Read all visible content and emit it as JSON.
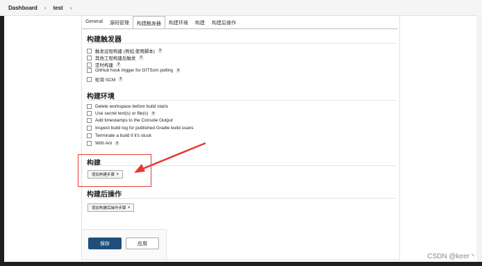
{
  "breadcrumb": {
    "dashboard": "Dashboard",
    "job": "test"
  },
  "tabs": [
    {
      "label": "General"
    },
    {
      "label": "源码管理"
    },
    {
      "label": "构建触发器"
    },
    {
      "label": "构建环境"
    },
    {
      "label": "构建"
    },
    {
      "label": "构建后操作"
    }
  ],
  "triggers": {
    "title": "构建触发器",
    "options": [
      {
        "label": "触发远程构建 (例如,使用脚本)"
      },
      {
        "label": "其他工程构建后触发"
      },
      {
        "label": "定时构建"
      },
      {
        "label": "GitHub hook trigger for GITScm polling"
      },
      {
        "label": "轮询 SCM"
      }
    ]
  },
  "environment": {
    "title": "构建环境",
    "options": [
      {
        "label": "Delete workspace before build starts"
      },
      {
        "label": "Use secret text(s) or file(s)"
      },
      {
        "label": "Add timestamps to the Console Output"
      },
      {
        "label": "Inspect build log for published Gradle build scans"
      },
      {
        "label": "Terminate a build if it's stuck"
      },
      {
        "label": "With Ant"
      }
    ]
  },
  "build": {
    "title": "构建",
    "add_step": "增加构建步骤"
  },
  "post_build": {
    "title": "构建后操作",
    "add_step": "增加构建后操作步骤"
  },
  "actions": {
    "save": "保存",
    "apply": "应用"
  },
  "help_glyph": "?",
  "caret_glyph": "▾",
  "chevron_glyph": "›",
  "footer": {
    "credit": "CSDN @keer丶"
  },
  "colors": {
    "save_bg": "#1e4f7a",
    "highlight": "#e53935",
    "arrow": "#e53935"
  }
}
